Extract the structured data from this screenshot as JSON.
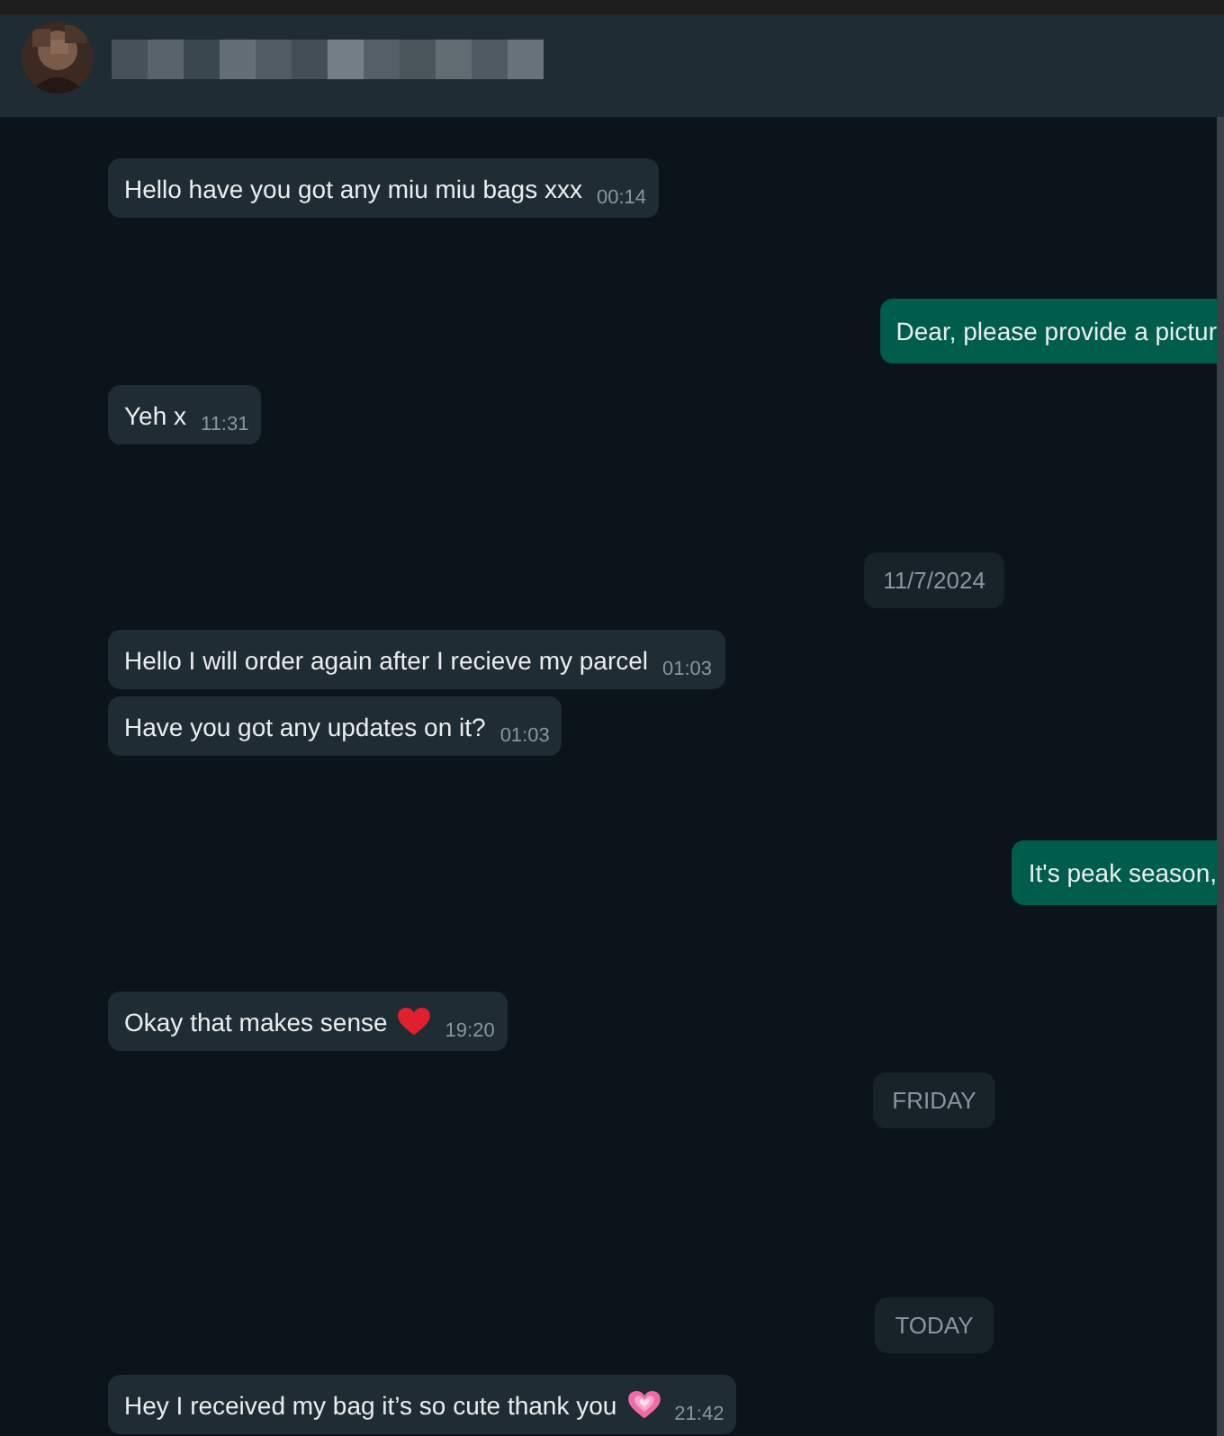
{
  "messages": [
    {
      "kind": "incoming",
      "text": "Hello have you got any miu miu bags xxx",
      "time": "00:14"
    },
    {
      "kind": "outgoing",
      "text": "Dear, please provide a pictur"
    },
    {
      "kind": "incoming",
      "text": "Yeh x",
      "time": "11:31"
    },
    {
      "kind": "date",
      "text": "11/7/2024"
    },
    {
      "kind": "incoming",
      "text": "Hello I will order again after I recieve my parcel",
      "time": "01:03"
    },
    {
      "kind": "incoming",
      "text": "Have you got any updates on it?",
      "time": "01:03"
    },
    {
      "kind": "outgoing",
      "text": "It's peak season,"
    },
    {
      "kind": "incoming",
      "text": "Okay that makes sense",
      "emoji": {
        "kind": "heart",
        "color": "#e0202e"
      },
      "time": "19:20"
    },
    {
      "kind": "date",
      "text": "FRIDAY"
    },
    {
      "kind": "date",
      "text": "TODAY"
    },
    {
      "kind": "incoming",
      "text": "Hey I received my bag it’s so cute thank you",
      "emoji": {
        "kind": "sparkling-heart",
        "color": "#f06aa8"
      },
      "time": "21:42"
    }
  ]
}
